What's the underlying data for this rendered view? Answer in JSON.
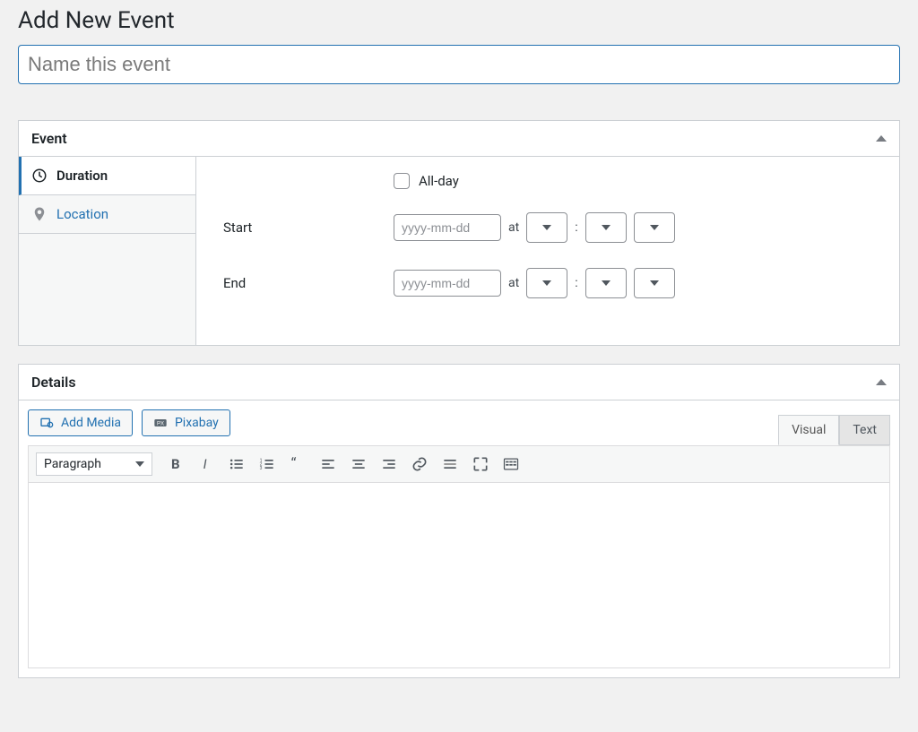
{
  "page": {
    "title": "Add New Event",
    "title_placeholder": "Name this event"
  },
  "panels": {
    "event": {
      "title": "Event",
      "tabs": {
        "duration": "Duration",
        "location": "Location"
      },
      "allday_label": "All-day",
      "start_label": "Start",
      "end_label": "End",
      "date_placeholder": "yyyy-mm-dd",
      "at_text": "at",
      "colon_text": ":"
    },
    "details": {
      "title": "Details",
      "add_media": "Add Media",
      "pixabay": "Pixabay",
      "tab_visual": "Visual",
      "tab_text": "Text",
      "format_select": "Paragraph"
    }
  }
}
